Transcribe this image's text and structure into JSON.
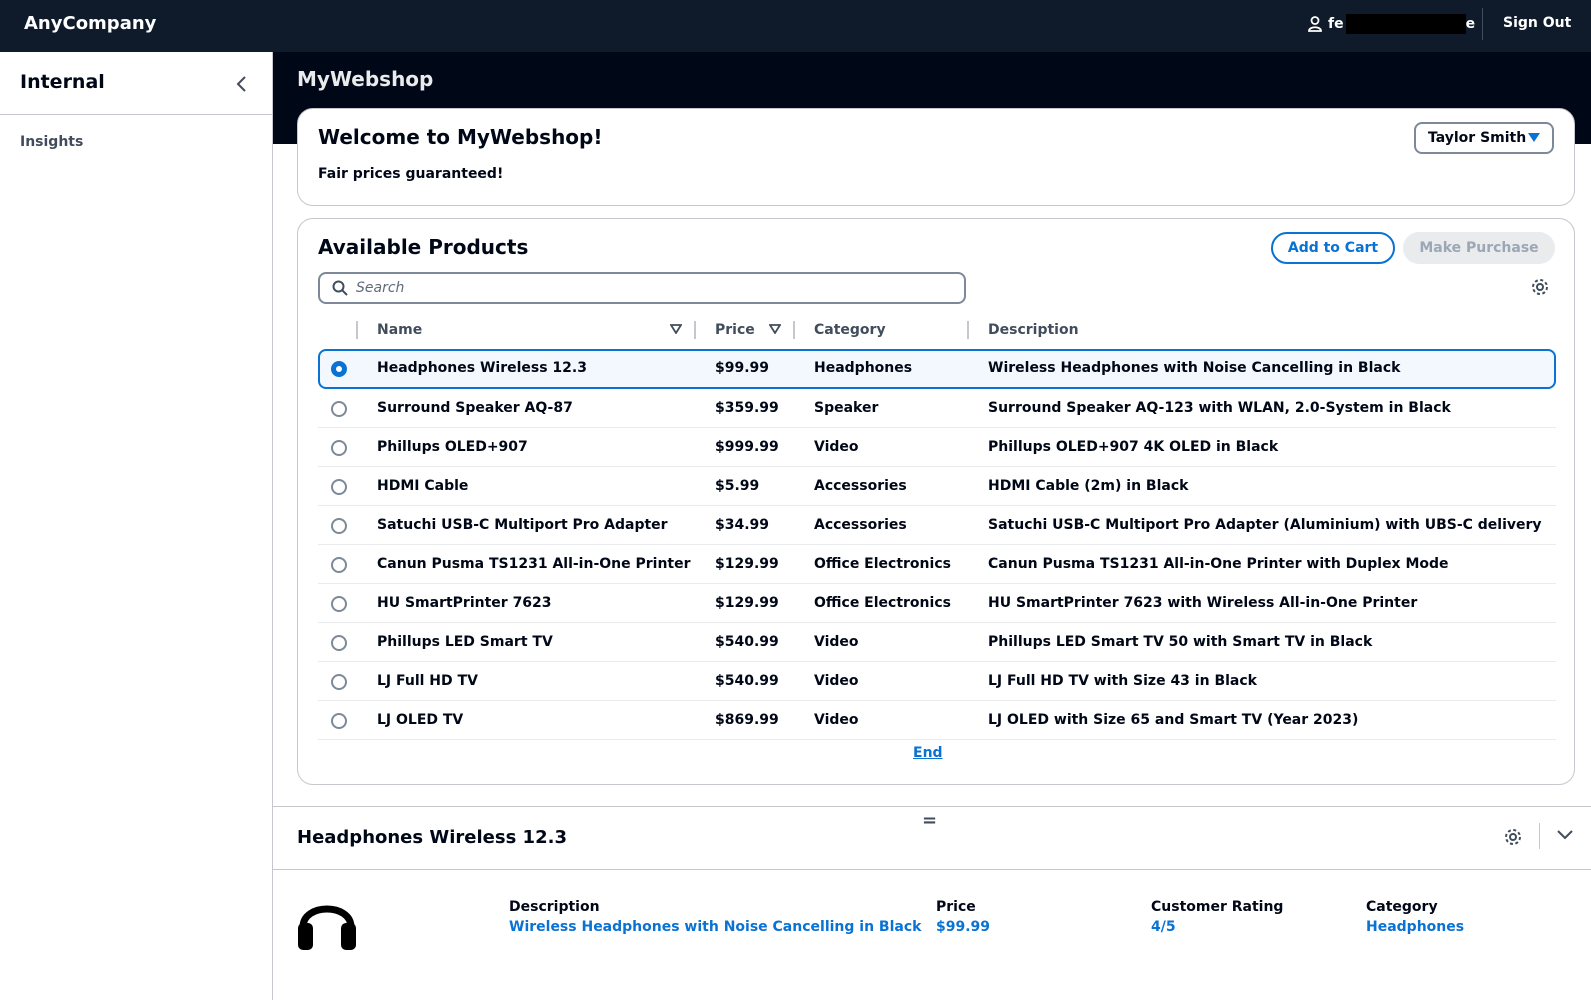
{
  "topnav": {
    "brand": "AnyCompany",
    "user_prefix": "fe",
    "user_suffix": "e",
    "sign_out": "Sign Out"
  },
  "sidenav": {
    "title": "Internal",
    "items": [
      {
        "label": "Insights"
      }
    ]
  },
  "main": {
    "title": "MyWebshop"
  },
  "welcome": {
    "title": "Welcome to MyWebshop!",
    "subtitle": "Fair prices guaranteed!",
    "user_select": "Taylor Smith"
  },
  "products": {
    "title": "Available Products",
    "add_to_cart": "Add to Cart",
    "make_purchase": "Make Purchase",
    "search_placeholder": "Search",
    "columns": {
      "name": "Name",
      "price": "Price",
      "category": "Category",
      "description": "Description"
    },
    "rows": [
      {
        "name": "Headphones Wireless 12.3",
        "price": "$99.99",
        "category": "Headphones",
        "description": "Wireless Headphones with Noise Cancelling in Black",
        "selected": true
      },
      {
        "name": "Surround Speaker AQ-87",
        "price": "$359.99",
        "category": "Speaker",
        "description": "Surround Speaker AQ-123 with WLAN, 2.0-System in Black"
      },
      {
        "name": "Phillups OLED+907",
        "price": "$999.99",
        "category": "Video",
        "description": "Phillups OLED+907 4K OLED in Black"
      },
      {
        "name": "HDMI Cable",
        "price": "$5.99",
        "category": "Accessories",
        "description": "HDMI Cable (2m) in Black"
      },
      {
        "name": "Satuchi USB-C Multiport Pro Adapter",
        "price": "$34.99",
        "category": "Accessories",
        "description": "Satuchi USB-C Multiport Pro Adapter (Aluminium) with UBS-C delivery"
      },
      {
        "name": "Canun Pusma TS1231 All-in-One Printer",
        "price": "$129.99",
        "category": "Office Electronics",
        "description": "Canun Pusma TS1231 All-in-One Printer with Duplex Mode"
      },
      {
        "name": "HU SmartPrinter 7623",
        "price": "$129.99",
        "category": "Office Electronics",
        "description": "HU SmartPrinter 7623 with Wireless All-in-One Printer"
      },
      {
        "name": "Phillups LED Smart TV",
        "price": "$540.99",
        "category": "Video",
        "description": "Phillups LED Smart TV 50 with Smart TV in Black"
      },
      {
        "name": "LJ Full HD TV",
        "price": "$540.99",
        "category": "Video",
        "description": "LJ Full HD TV with Size 43 in Black"
      },
      {
        "name": "LJ OLED TV",
        "price": "$869.99",
        "category": "Video",
        "description": "LJ OLED with Size 65 and Smart TV (Year 2023)"
      }
    ],
    "end_label": "End"
  },
  "details": {
    "title": "Headphones Wireless 12.3",
    "handle": "=",
    "image_icon": "headphones-icon",
    "description_label": "Description",
    "description_value": "Wireless Headphones with Noise Cancelling in Black",
    "price_label": "Price",
    "price_value": "$99.99",
    "rating_label": "Customer Rating",
    "rating_value": "4/5",
    "category_label": "Category",
    "category_value": "Headphones"
  },
  "colors": {
    "accent": "#0972d3",
    "topnav": "#0f1b2a",
    "header_band": "#000716"
  }
}
